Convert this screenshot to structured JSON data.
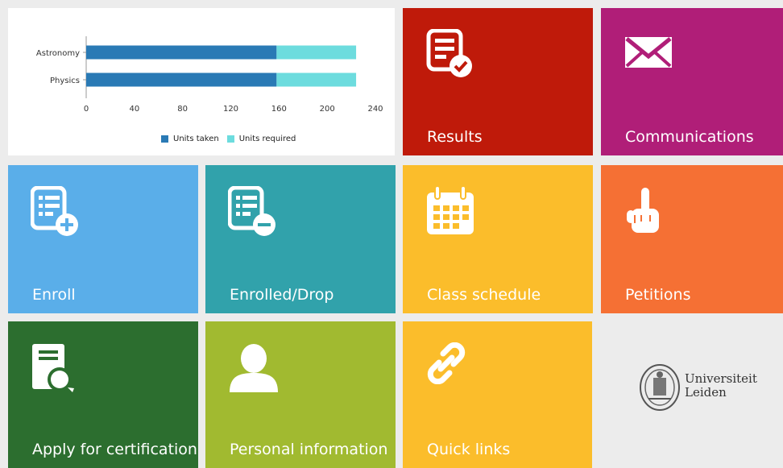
{
  "chart_data": {
    "type": "bar",
    "orientation": "horizontal",
    "stacked": true,
    "categories": [
      "Astronomy",
      "Physics"
    ],
    "series": [
      {
        "name": "Units taken",
        "values": [
          158,
          158
        ],
        "color": "#2a7ab5"
      },
      {
        "name": "Units required",
        "values": [
          66,
          66
        ],
        "color": "#6ddcde"
      }
    ],
    "xlim": [
      0,
      240
    ],
    "xticks": [
      "0",
      "40",
      "80",
      "120",
      "160",
      "200",
      "240"
    ],
    "legend": "bottom"
  },
  "tiles": {
    "results": {
      "label": "Results",
      "color": "#bf1a0a",
      "icon": "results-checklist-icon"
    },
    "communications": {
      "label": "Communications",
      "color": "#b01e78",
      "icon": "envelope-icon"
    },
    "enroll": {
      "label": "Enroll",
      "color": "#5aaee9",
      "icon": "list-add-icon"
    },
    "enrolled_drop": {
      "label": "Enrolled/Drop",
      "color": "#31a2ab",
      "icon": "list-remove-icon"
    },
    "class_schedule": {
      "label": "Class schedule",
      "color": "#fbbd2b",
      "icon": "calendar-icon"
    },
    "petitions": {
      "label": "Petitions",
      "color": "#f57034",
      "icon": "raised-hand-icon"
    },
    "certification": {
      "label": "Apply for certification",
      "color": "#2c6e2f",
      "icon": "certificate-icon"
    },
    "personal_info": {
      "label": "Personal information",
      "color": "#a1ba30",
      "icon": "person-icon"
    },
    "quick_links": {
      "label": "Quick links",
      "color": "#fbbd2b",
      "icon": "link-icon"
    }
  },
  "logo": {
    "line1": "Universiteit",
    "line2": "Leiden"
  }
}
